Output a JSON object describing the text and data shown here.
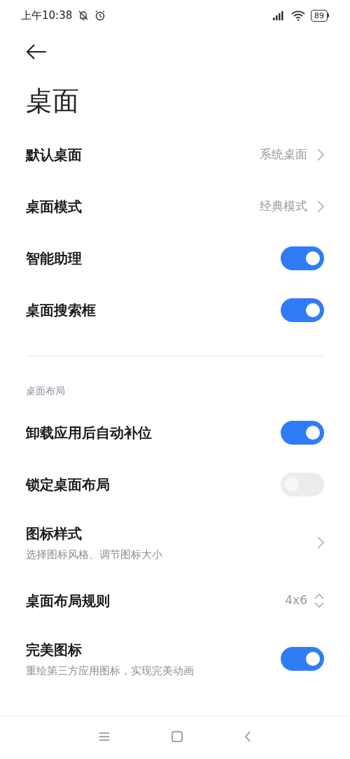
{
  "status_bar": {
    "time": "上午10:38",
    "battery": "89"
  },
  "title": "桌面",
  "groups": [
    {
      "items": [
        {
          "kind": "link",
          "label": "默认桌面",
          "value": "系统桌面"
        },
        {
          "kind": "link",
          "label": "桌面模式",
          "value": "经典模式"
        },
        {
          "kind": "toggle",
          "label": "智能助理",
          "on": true
        },
        {
          "kind": "toggle",
          "label": "桌面搜索框",
          "on": true
        }
      ]
    },
    {
      "header": "桌面布局",
      "items": [
        {
          "kind": "toggle",
          "label": "卸载应用后自动补位",
          "on": true
        },
        {
          "kind": "toggle",
          "label": "锁定桌面布局",
          "on": false,
          "disabled": true
        },
        {
          "kind": "link",
          "label": "图标样式",
          "subtitle": "选择图标风格、调节图标大小"
        },
        {
          "kind": "spinner",
          "label": "桌面布局规则",
          "value": "4x6"
        },
        {
          "kind": "toggle",
          "label": "完美图标",
          "subtitle": "重绘第三方应用图标，实现完美动画",
          "on": true
        }
      ]
    }
  ]
}
